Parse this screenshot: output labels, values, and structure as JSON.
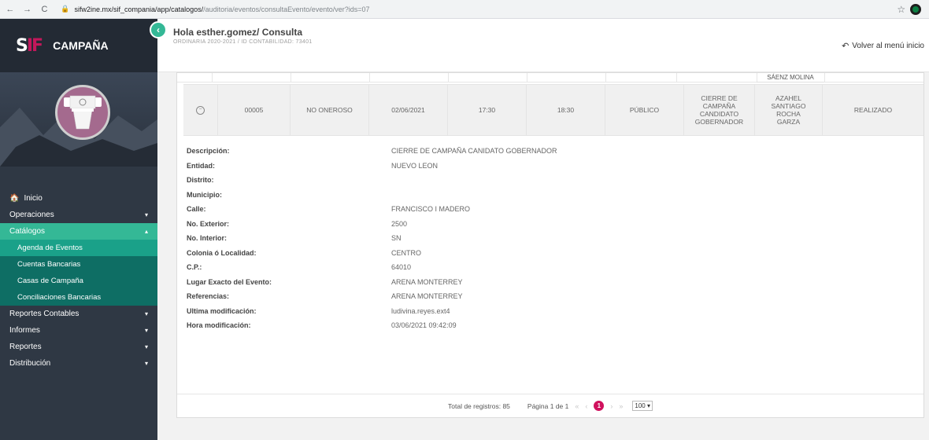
{
  "browser": {
    "url_main": "sifw2ine.mx/sif_compania/app/catalogos/",
    "url_rest": "/auditoria/eventos/consultaEvento/evento/ver?ids=07"
  },
  "sidebar": {
    "logo_text": "S",
    "logo_accent": "IF",
    "brand": "CAMPAÑA",
    "collapse_icon": "‹",
    "menu": [
      {
        "label": "Inicio",
        "icon": "home-icon"
      },
      {
        "label": "Operaciones",
        "chevron": "▾"
      },
      {
        "label": "Catálogos",
        "chevron": "▴"
      }
    ],
    "submenu": [
      {
        "label": "Agenda de Eventos"
      },
      {
        "label": "Cuentas Bancarias"
      },
      {
        "label": "Casas de Campaña"
      },
      {
        "label": "Conciliaciones Bancarias"
      }
    ],
    "menu_after": [
      {
        "label": "Reportes Contables",
        "chevron": "▾"
      },
      {
        "label": "Informes",
        "chevron": "▾"
      },
      {
        "label": "Reportes",
        "chevron": "▾"
      },
      {
        "label": "Distribución",
        "chevron": "▾"
      }
    ]
  },
  "header": {
    "greeting": "Hola esther.gomez/ Consulta",
    "subtitle": "ORDINARIA 2020-2021 / ID CONTABILIDAD: 73401",
    "back_label": "Volver al menú inicio"
  },
  "event": {
    "above_name": "SÁENZ MOLINA",
    "cells": [
      "00005",
      "NO ONEROSO",
      "02/06/2021",
      "17:30",
      "18:30",
      "PÚBLICO",
      "CIERRE DE CAMPAÑA CANDIDATO GOBERNADOR",
      "AZAHEL SANTIAGO ROCHA GARZA",
      "REALIZADO"
    ]
  },
  "details": [
    {
      "label": "Descripción:",
      "value": "CIERRE DE CAMPAÑA CANIDATO GOBERNADOR"
    },
    {
      "label": "Entidad:",
      "value": "NUEVO LEON"
    },
    {
      "label": "Distrito:",
      "value": ""
    },
    {
      "label": "Municipio:",
      "value": ""
    },
    {
      "label": "Calle:",
      "value": "FRANCISCO I MADERO"
    },
    {
      "label": "No. Exterior:",
      "value": "2500"
    },
    {
      "label": "No. Interior:",
      "value": "SN"
    },
    {
      "label": "Colonia ó Localidad:",
      "value": "CENTRO"
    },
    {
      "label": "C.P.:",
      "value": "64010"
    },
    {
      "label": "Lugar Exacto del Evento:",
      "value": "ARENA MONTERREY"
    },
    {
      "label": "Referencias:",
      "value": "ARENA MONTERREY"
    },
    {
      "label": "Ultima modificación:",
      "value": "ludivina.reyes.ext4"
    },
    {
      "label": "Hora modificación:",
      "value": "03/06/2021 09:42:09"
    }
  ],
  "pagination": {
    "total": "Total de registros: 85",
    "page": "Página 1 de 1",
    "first": "«",
    "prev": "‹",
    "current": "1",
    "next": "›",
    "last": "»",
    "size": "100 ▾"
  },
  "colors": {
    "sidebar": "#2f3844",
    "accent": "#34b896",
    "pager": "#d0115d"
  }
}
